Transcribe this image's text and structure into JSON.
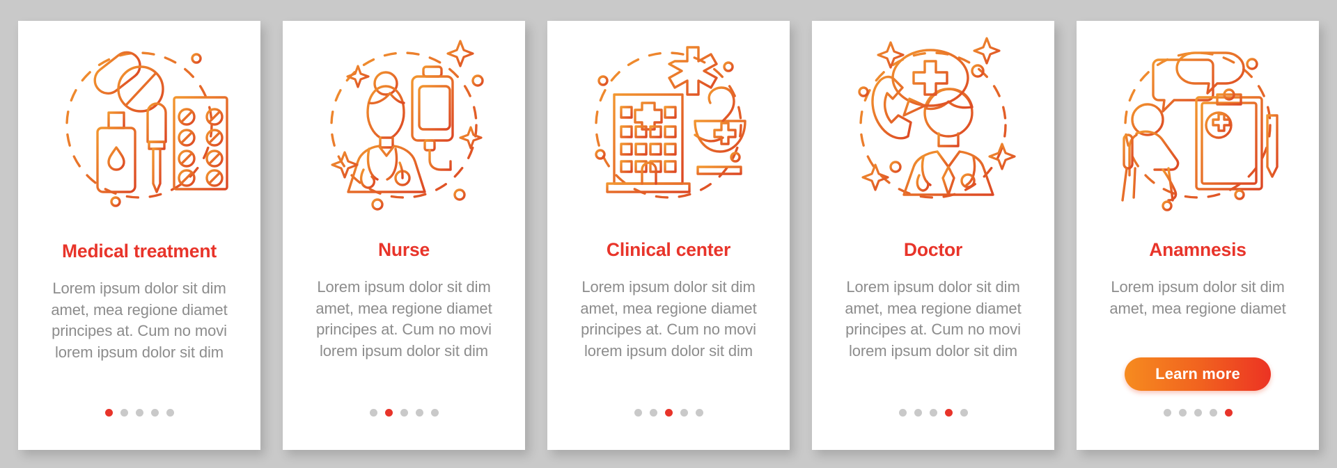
{
  "theme": {
    "background": "#c9c9c9",
    "card_background": "#ffffff",
    "title_color": "#e8342a",
    "body_color": "#8c8c8c",
    "icon_color_start": "#f08a31",
    "icon_color_end": "#dd4a25",
    "dot_inactive": "#c9c9c9",
    "dot_active": "#e8342a",
    "cta_gradient_start": "#f68b1f",
    "cta_gradient_end": "#ec3323"
  },
  "pagination": {
    "total": 5
  },
  "cards": [
    {
      "icon": "pills-medication-icon",
      "title": "Medical treatment",
      "body": "Lorem ipsum dolor sit dim amet, mea regione diamet principes at. Cum no movi lorem ipsum dolor sit dim",
      "active_dot": 0,
      "cta": null
    },
    {
      "icon": "nurse-iv-drip-icon",
      "title": "Nurse",
      "body": "Lorem ipsum dolor sit dim amet, mea regione diamet principes at. Cum no movi lorem ipsum dolor sit dim",
      "active_dot": 1,
      "cta": null
    },
    {
      "icon": "hospital-building-icon",
      "title": "Clinical center",
      "body": "Lorem ipsum dolor sit dim amet, mea regione diamet principes at. Cum no movi lorem ipsum dolor sit dim",
      "active_dot": 2,
      "cta": null
    },
    {
      "icon": "doctor-call-icon",
      "title": "Doctor",
      "body": "Lorem ipsum dolor sit dim amet, mea regione diamet principes at. Cum no movi lorem ipsum dolor sit dim",
      "active_dot": 3,
      "cta": null
    },
    {
      "icon": "patient-interview-clipboard-icon",
      "title": "Anamnesis",
      "body": "Lorem ipsum dolor sit dim amet, mea regione diamet",
      "active_dot": 4,
      "cta": "Learn more"
    }
  ]
}
